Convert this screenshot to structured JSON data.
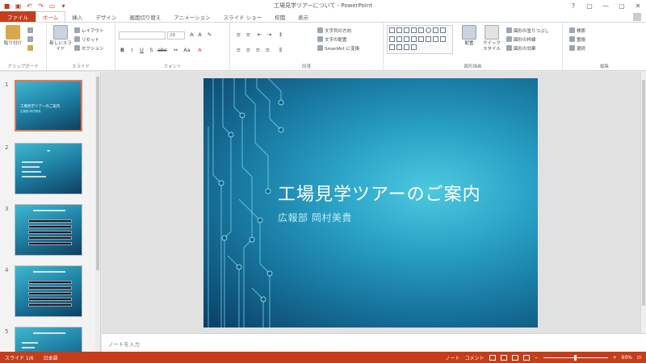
{
  "window": {
    "title": "工場見学ツアーについて - PowerPoint",
    "controls": [
      "?",
      "▢",
      "—",
      "▢",
      "✕"
    ]
  },
  "tabs": [
    {
      "label": "ファイル",
      "kind": "file"
    },
    {
      "label": "ホーム",
      "kind": "active"
    },
    {
      "label": "挿入",
      "kind": ""
    },
    {
      "label": "デザイン",
      "kind": ""
    },
    {
      "label": "画面切り替え",
      "kind": ""
    },
    {
      "label": "アニメーション",
      "kind": ""
    },
    {
      "label": "スライド ショー",
      "kind": ""
    },
    {
      "label": "校閲",
      "kind": ""
    },
    {
      "label": "表示",
      "kind": ""
    }
  ],
  "ribbon": {
    "clipboard": {
      "paste": "貼り付け",
      "label": "クリップボード"
    },
    "slides": {
      "new_slide": "新しいスライド",
      "layout": "レイアウト",
      "reset": "リセット",
      "section": "セクション",
      "label": "スライド"
    },
    "font": {
      "size": "28",
      "label": "フォント"
    },
    "paragraph": {
      "text_direction": "文字列の方向",
      "align_text": "文字の配置",
      "smartart": "SmartArt に変換",
      "label": "段落"
    },
    "drawing": {
      "arrange": "配置",
      "quick_styles": "クイック スタイル",
      "fill": "図形の塗りつぶし",
      "outline": "図形の枠線",
      "effects": "図形の効果",
      "label": "図形描画"
    },
    "editing": {
      "find": "検索",
      "replace": "置換",
      "select": "選択",
      "label": "編集"
    }
  },
  "thumbnails": [
    {
      "number": "1",
      "title": "工場見学ツアーのご案内",
      "subtitle": "広報部 岡村美貴"
    },
    {
      "number": "2",
      "title": "",
      "subtitle": ""
    },
    {
      "number": "3",
      "title": "",
      "subtitle": ""
    },
    {
      "number": "4",
      "title": "",
      "subtitle": ""
    },
    {
      "number": "5",
      "title": "",
      "subtitle": ""
    }
  ],
  "slide": {
    "title": "工場見学ツアーのご案内",
    "subtitle": "広報部 岡村美貴"
  },
  "notes": {
    "placeholder": "ノートを入力"
  },
  "status": {
    "slide_count": "スライド 1/6",
    "language": "日本語",
    "notes": "ノート",
    "comments": "コメント",
    "zoom": "60%"
  },
  "colors": {
    "accent": "#c43e1c",
    "slide_dark": "#0b3d63",
    "slide_light": "#4ec9e0"
  }
}
